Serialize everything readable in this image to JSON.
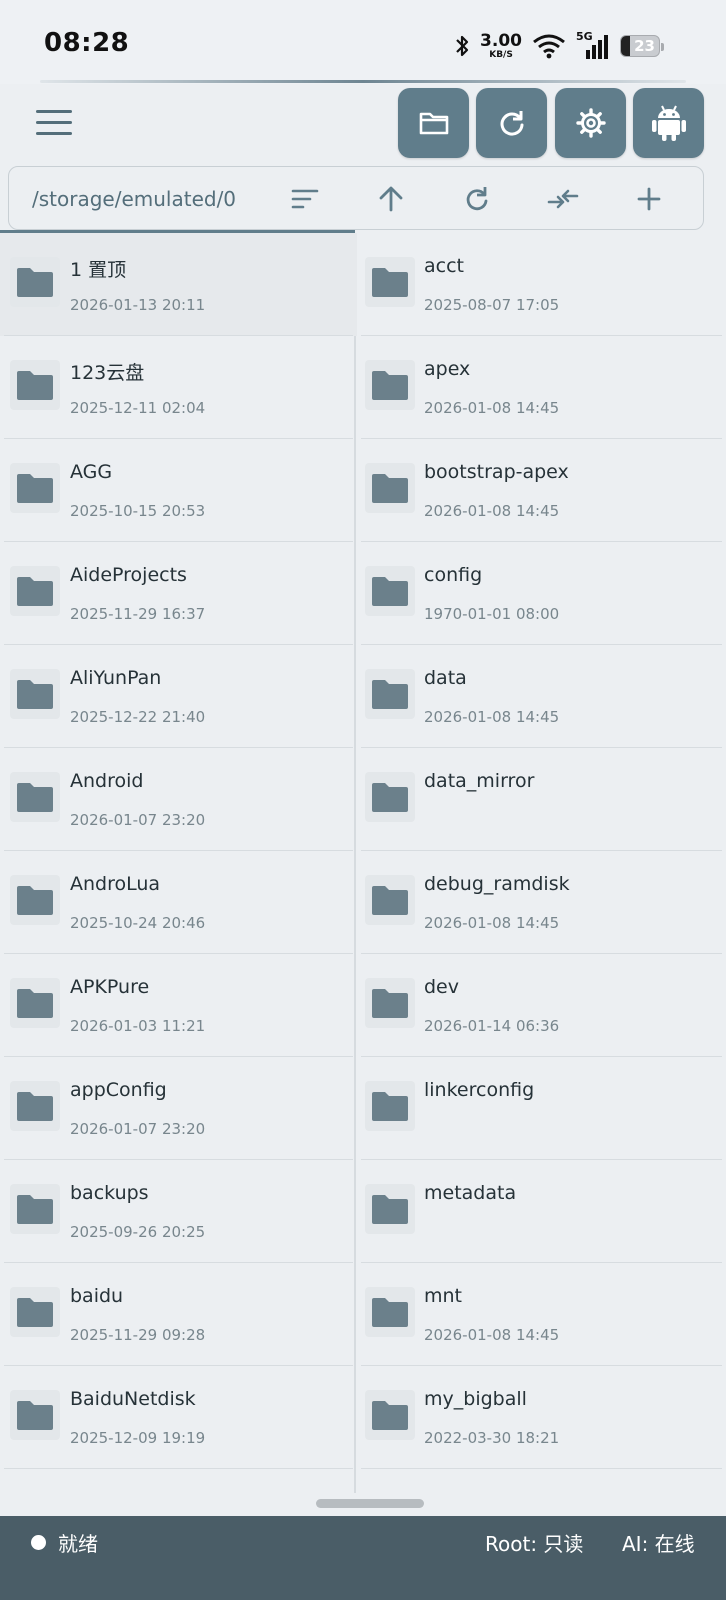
{
  "status_bar": {
    "time": "08:28",
    "net_speed_value": "3.00",
    "net_speed_unit": "KB/S",
    "network": "5G",
    "battery_level": "23"
  },
  "toolbar": {
    "menu_icon": "hamburger-menu-icon",
    "buttons": [
      "folder-icon",
      "refresh-icon",
      "settings-gear-icon",
      "android-icon"
    ]
  },
  "path_bar": {
    "path": "/storage/emulated/0",
    "actions": [
      "sort-icon",
      "up-arrow-icon",
      "reload-icon",
      "swap-arrows-icon",
      "add-icon"
    ]
  },
  "files": {
    "left": [
      {
        "name": "1 置顶",
        "date": "2026-01-13 20:11"
      },
      {
        "name": "123云盘",
        "date": "2025-12-11 02:04"
      },
      {
        "name": "AGG",
        "date": "2025-10-15 20:53"
      },
      {
        "name": "AideProjects",
        "date": "2025-11-29 16:37"
      },
      {
        "name": "AliYunPan",
        "date": "2025-12-22 21:40"
      },
      {
        "name": "Android",
        "date": "2026-01-07 23:20"
      },
      {
        "name": "AndroLua",
        "date": "2025-10-24 20:46"
      },
      {
        "name": "APKPure",
        "date": "2026-01-03 11:21"
      },
      {
        "name": "appConfig",
        "date": "2026-01-07 23:20"
      },
      {
        "name": "backups",
        "date": "2025-09-26 20:25"
      },
      {
        "name": "baidu",
        "date": "2025-11-29 09:28"
      },
      {
        "name": "BaiduNetdisk",
        "date": "2025-12-09 19:19"
      }
    ],
    "right": [
      {
        "name": "acct",
        "date": "2025-08-07 17:05"
      },
      {
        "name": "apex",
        "date": "2026-01-08 14:45"
      },
      {
        "name": "bootstrap-apex",
        "date": "2026-01-08 14:45"
      },
      {
        "name": "config",
        "date": "1970-01-01 08:00"
      },
      {
        "name": "data",
        "date": "2026-01-08 14:45"
      },
      {
        "name": "data_mirror",
        "date": ""
      },
      {
        "name": "debug_ramdisk",
        "date": "2026-01-08 14:45"
      },
      {
        "name": "dev",
        "date": "2026-01-14 06:36"
      },
      {
        "name": "linkerconfig",
        "date": ""
      },
      {
        "name": "metadata",
        "date": ""
      },
      {
        "name": "mnt",
        "date": "2026-01-08 14:45"
      },
      {
        "name": "my_bigball",
        "date": "2022-03-30 18:21"
      }
    ]
  },
  "bottom_bar": {
    "status": "就绪",
    "root": "Root: 只读",
    "ai": "AI: 在线"
  },
  "colors": {
    "accent": "#607d8b",
    "folder_icon": "#6b808b",
    "bottom_bar": "#4a5d67",
    "background": "#eceff2"
  }
}
